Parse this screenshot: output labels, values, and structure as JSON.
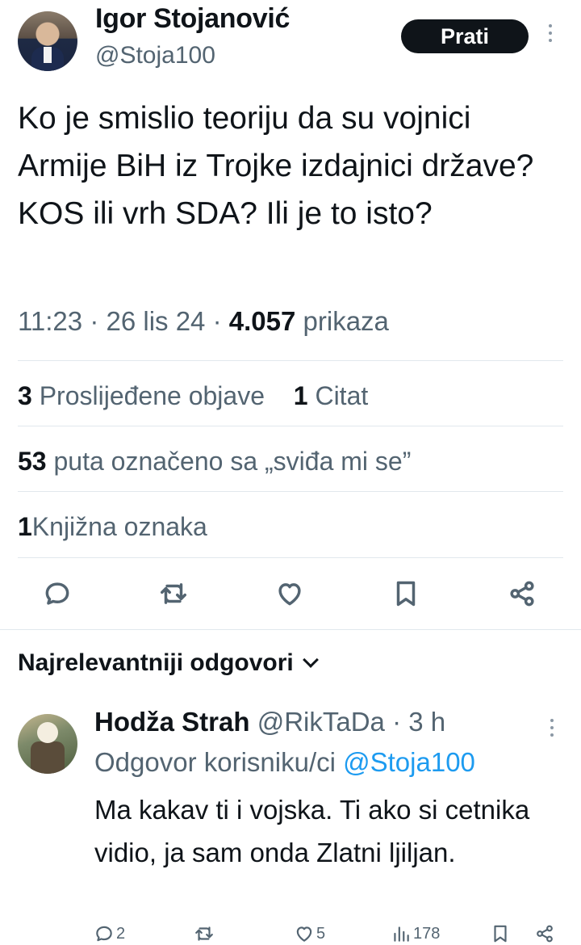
{
  "author": {
    "name": "Igor Stojanović",
    "handle": "@Stoja100",
    "follow_label": "Prati"
  },
  "tweet": {
    "text": "Ko je smislio teoriju da su vojnici Armije BiH iz Trojke izdajnici države? KOS ili vrh SDA? Ili je to isto?",
    "time": "11:23",
    "date": "26 lis 24",
    "views_count": "4.057",
    "views_label": "prikaza"
  },
  "stats": {
    "reposts_count": "3",
    "reposts_label": "Proslijeđene objave",
    "quotes_count": "1",
    "quotes_label": "Citat",
    "likes_count": "53",
    "likes_label": "puta označeno sa „sviđa mi se”",
    "bookmarks_count": "1",
    "bookmarks_label": "Knjižna oznaka"
  },
  "actions": {
    "icons": [
      "reply-icon",
      "retweet-icon",
      "like-icon",
      "bookmark-icon",
      "share-icon"
    ]
  },
  "replies": {
    "header": "Najrelevantniji odgovori",
    "items": [
      {
        "name": "Hodža Strah",
        "handle": "@RikTaDa",
        "time": "3 h",
        "replying_to_prefix": "Odgovor korisniku/ci",
        "replying_to": "@Stoja100",
        "text": "Ma kakav ti i vojska. Ti ako si cetnika vidio, ja sam onda Zlatni ljiljan.",
        "reply_count": "2",
        "retweet_count": "",
        "like_count": "5",
        "view_count": "178"
      }
    ]
  },
  "colors": {
    "text": "#0f1419",
    "secondary": "#536471",
    "link": "#1d9bf0",
    "divider": "#e1e8ed",
    "button_bg": "#0f1419"
  }
}
